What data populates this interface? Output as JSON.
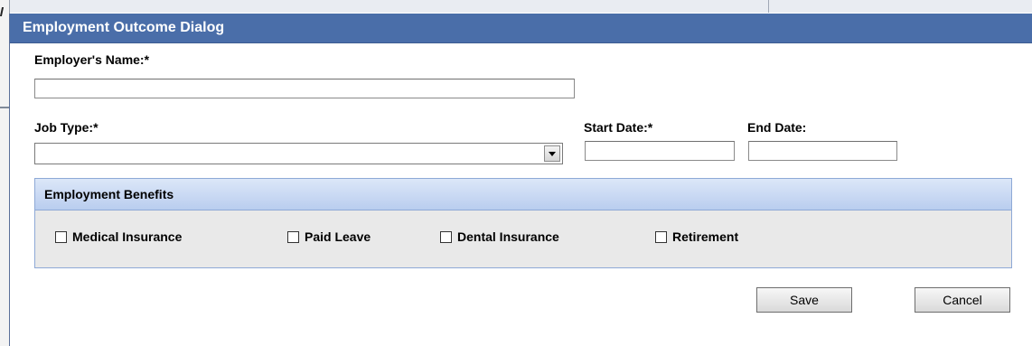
{
  "dialog": {
    "title": "Employment Outcome Dialog"
  },
  "form": {
    "employer_name_label": "Employer's Name:*",
    "employer_name_value": "",
    "job_type_label": "Job Type:*",
    "job_type_value": "",
    "start_date_label": "Start Date:*",
    "start_date_value": "",
    "end_date_label": "End Date:",
    "end_date_value": ""
  },
  "benefits": {
    "title": "Employment Benefits",
    "items": [
      {
        "label": "Medical Insurance",
        "checked": false
      },
      {
        "label": "Paid Leave",
        "checked": false
      },
      {
        "label": "Dental Insurance",
        "checked": false
      },
      {
        "label": "Retirement",
        "checked": false
      }
    ]
  },
  "buttons": {
    "save_label": "Save",
    "cancel_label": "Cancel"
  },
  "colors": {
    "titlebar": "#4a6ea9",
    "benefits_header": "#b9cdef",
    "benefits_body": "#e9e9e9"
  },
  "icons": {
    "select_arrow": "chevron-down-icon"
  }
}
